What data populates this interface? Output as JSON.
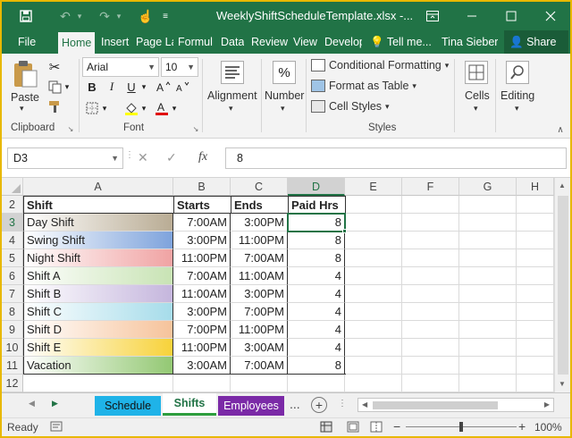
{
  "window": {
    "title": "WeeklyShiftScheduleTemplate.xlsx -...",
    "user": "Tina Sieber",
    "share_label": "Share",
    "tell_me": "Tell me..."
  },
  "tabs": [
    {
      "label": "File"
    },
    {
      "label": "Home"
    },
    {
      "label": "Insert"
    },
    {
      "label": "Page La"
    },
    {
      "label": "Formul"
    },
    {
      "label": "Data"
    },
    {
      "label": "Review"
    },
    {
      "label": "View"
    },
    {
      "label": "Develop"
    }
  ],
  "ribbon": {
    "clipboard": {
      "paste_label": "Paste",
      "group_label": "Clipboard"
    },
    "font": {
      "name": "Arial",
      "size": "10",
      "group_label": "Font",
      "bold": "B",
      "italic": "I",
      "underline": "U"
    },
    "alignment_label": "Alignment",
    "number_label": "Number",
    "number_icon": "%",
    "styles": {
      "conditional": "Conditional Formatting",
      "table": "Format as Table",
      "cell_styles": "Cell Styles",
      "group_label": "Styles"
    },
    "cells_label": "Cells",
    "editing_label": "Editing"
  },
  "formula_bar": {
    "name_box": "D3",
    "fx_icon": "fx",
    "value": "8"
  },
  "grid": {
    "columns": [
      "A",
      "B",
      "C",
      "D",
      "E",
      "F",
      "G",
      "H"
    ],
    "selected_column": "D",
    "selected_row": "3",
    "header_row": {
      "row": "2",
      "cells": [
        "Shift",
        "Starts",
        "Ends",
        "Paid Hrs"
      ]
    },
    "rows": [
      {
        "row": "3",
        "shift": "Day Shift",
        "starts": "7:00AM",
        "ends": "3:00PM",
        "paid": "8",
        "color": "#b9ac94"
      },
      {
        "row": "4",
        "shift": "Swing Shift",
        "starts": "3:00PM",
        "ends": "11:00PM",
        "paid": "8",
        "color": "#7ea3dc"
      },
      {
        "row": "5",
        "shift": "Night Shift",
        "starts": "11:00PM",
        "ends": "7:00AM",
        "paid": "8",
        "color": "#f0a3a3"
      },
      {
        "row": "6",
        "shift": "Shift A",
        "starts": "7:00AM",
        "ends": "11:00AM",
        "paid": "4",
        "color": "#c8e3b4"
      },
      {
        "row": "7",
        "shift": "Shift B",
        "starts": "11:00AM",
        "ends": "3:00PM",
        "paid": "4",
        "color": "#c5b6dd"
      },
      {
        "row": "8",
        "shift": "Shift C",
        "starts": "3:00PM",
        "ends": "7:00PM",
        "paid": "4",
        "color": "#a6dcea"
      },
      {
        "row": "9",
        "shift": "Shift  D",
        "starts": "7:00PM",
        "ends": "11:00PM",
        "paid": "4",
        "color": "#f6c39b"
      },
      {
        "row": "10",
        "shift": "Shift E",
        "starts": "11:00PM",
        "ends": "3:00AM",
        "paid": "4",
        "color": "#f7d23a"
      },
      {
        "row": "11",
        "shift": "Vacation",
        "starts": "3:00AM",
        "ends": "7:00AM",
        "paid": "8",
        "color": "#93c873"
      }
    ],
    "empty_row": "12"
  },
  "sheets": [
    {
      "label": "Schedule",
      "color": "#1fb3e8"
    },
    {
      "label": "Shifts",
      "color": "#2e9e3e",
      "active": true
    },
    {
      "label": "Employees",
      "color": "#7b2aa7"
    }
  ],
  "sheet_more": "...",
  "status": {
    "ready": "Ready",
    "zoom": "100%"
  },
  "accent_color": "#217346"
}
